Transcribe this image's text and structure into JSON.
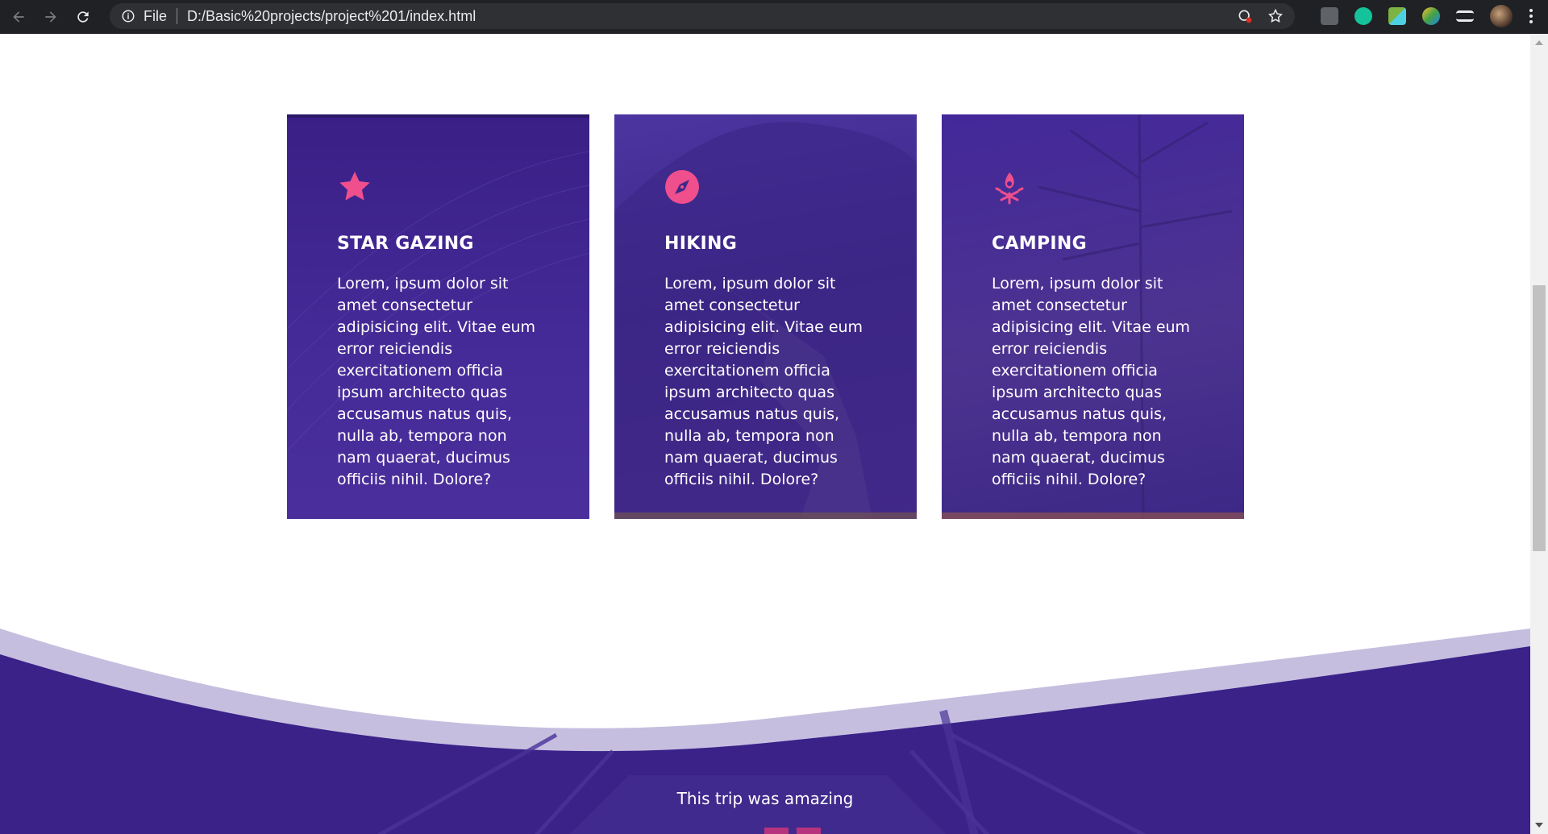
{
  "browser": {
    "scheme": "File",
    "url": "D:/Basic%20projects/project%201/index.html"
  },
  "colors": {
    "accent_pink": "#ef4f8c",
    "card_purple": "#452b98",
    "section_purple": "#3a2289"
  },
  "cards": [
    {
      "icon": "star-icon",
      "title": "STAR GAZING",
      "text": "Lorem, ipsum dolor sit amet consectetur adipisicing elit. Vitae eum error reiciendis exercitationem officia ipsum architecto quas accusamus natus quis, nulla ab, tempora non nam quaerat, ducimus officiis nihil. Dolore?"
    },
    {
      "icon": "compass-icon",
      "title": "HIKING",
      "text": "Lorem, ipsum dolor sit amet consectetur adipisicing elit. Vitae eum error reiciendis exercitationem officia ipsum architecto quas accusamus natus quis, nulla ab, tempora non nam quaerat, ducimus officiis nihil. Dolore?"
    },
    {
      "icon": "campfire-icon",
      "title": "CAMPING",
      "text": "Lorem, ipsum dolor sit amet consectetur adipisicing elit. Vitae eum error reiciendis exercitationem officia ipsum architecto quas accusamus natus quis, nulla ab, tempora non nam quaerat, ducimus officiis nihil. Dolore?"
    }
  ],
  "testimonial": {
    "quote": "This trip was amazing"
  }
}
